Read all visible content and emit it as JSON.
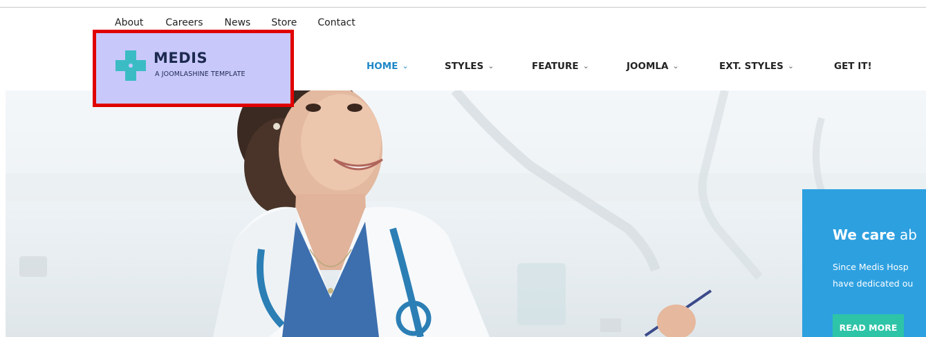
{
  "top_nav": {
    "links": [
      "About",
      "Careers",
      "News",
      "Store",
      "Contact"
    ]
  },
  "logo": {
    "name": "MEDIS",
    "tagline": "A JOOMLASHINE TEMPLATE",
    "icon": "medical-cross-icon",
    "highlight_border_color": "#e00000",
    "highlight_fill_color": "#c8c8fb"
  },
  "main_nav": {
    "items": [
      {
        "label": "HOME",
        "has_dropdown": true,
        "active": true
      },
      {
        "label": "STYLES",
        "has_dropdown": true,
        "active": false
      },
      {
        "label": "FEATURE",
        "has_dropdown": true,
        "active": false
      },
      {
        "label": "JOOMLA",
        "has_dropdown": true,
        "active": false
      },
      {
        "label": "EXT. STYLES",
        "has_dropdown": true,
        "active": false
      },
      {
        "label": "GET IT!",
        "has_dropdown": false,
        "active": false
      }
    ],
    "chevron": "⌄",
    "active_color": "#1e88c7"
  },
  "hero": {
    "image": "doctor-with-stethoscope-photo",
    "callout": {
      "title_bold": "We care",
      "title_rest": "ab",
      "line1": "Since Medis Hosp",
      "line2": "have dedicated ou",
      "button_label": "READ MORE",
      "panel_color": "#2da0e0",
      "button_color": "#2ec4a8"
    }
  }
}
